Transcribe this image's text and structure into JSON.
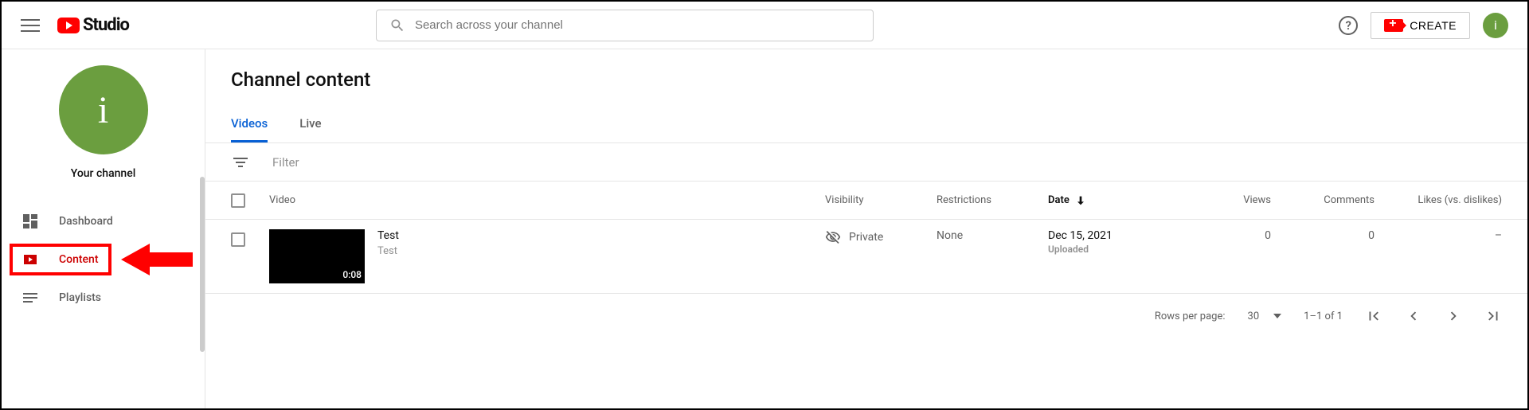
{
  "header": {
    "logo_text": "Studio",
    "search_placeholder": "Search across your channel",
    "create_label": "CREATE",
    "avatar_letter": "i"
  },
  "sidebar": {
    "avatar_letter": "i",
    "channel_label": "Your channel",
    "items": [
      {
        "id": "dashboard",
        "label": "Dashboard"
      },
      {
        "id": "content",
        "label": "Content"
      },
      {
        "id": "playlists",
        "label": "Playlists"
      }
    ]
  },
  "page": {
    "title": "Channel content",
    "tabs": [
      {
        "id": "videos",
        "label": "Videos",
        "active": true
      },
      {
        "id": "live",
        "label": "Live",
        "active": false
      }
    ],
    "filter_placeholder": "Filter",
    "columns": {
      "video": "Video",
      "visibility": "Visibility",
      "restrictions": "Restrictions",
      "date": "Date",
      "views": "Views",
      "comments": "Comments",
      "likes": "Likes (vs. dislikes)"
    },
    "rows": [
      {
        "title": "Test",
        "description": "Test",
        "duration": "0:08",
        "visibility": "Private",
        "restrictions": "None",
        "date": "Dec 15, 2021",
        "date_status": "Uploaded",
        "views": "0",
        "comments": "0",
        "likes": "–"
      }
    ],
    "pagination": {
      "rows_per_page_label": "Rows per page:",
      "rows_per_page_value": "30",
      "range": "1–1 of 1"
    }
  }
}
